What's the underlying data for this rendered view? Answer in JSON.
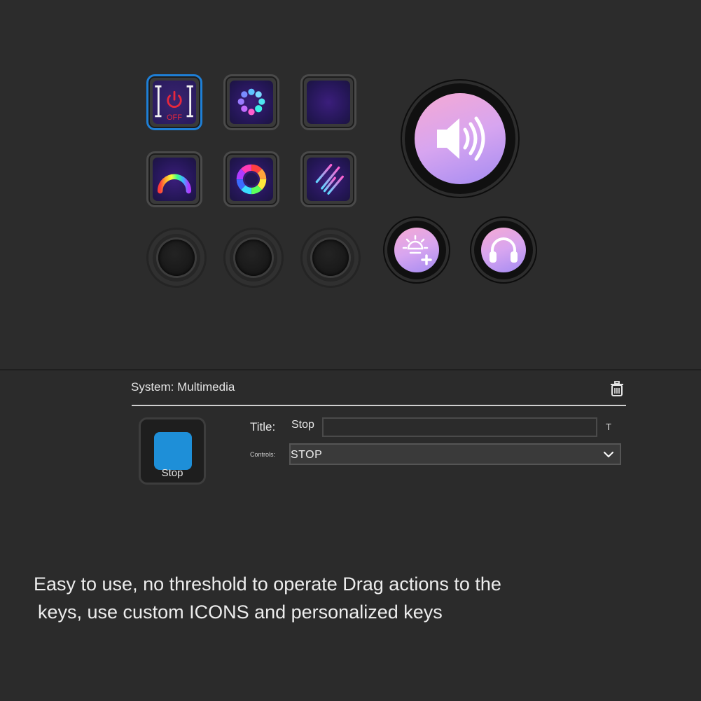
{
  "panel": {
    "title": "System: Multimedia",
    "preview_label": "Stop",
    "title_label": "Title:",
    "title_value": "Stop",
    "title_format_glyph": "T",
    "controls_label": "Controls:",
    "controls_value": "STOP"
  },
  "keys": [
    {
      "name": "power-off-key",
      "icon": "power-off-icon",
      "text": "OFF",
      "selected": true
    },
    {
      "name": "dots-circle-key",
      "icon": "dots-ring-icon"
    },
    {
      "name": "equalizer-key",
      "icon": "equalizer-icon"
    },
    {
      "name": "rainbow-arc-key",
      "icon": "rainbow-arc-icon"
    },
    {
      "name": "color-wheel-key",
      "icon": "color-wheel-icon"
    },
    {
      "name": "meteor-key",
      "icon": "meteor-icon"
    }
  ],
  "round_buttons": [
    {
      "name": "volume-button",
      "icon": "speaker-icon"
    },
    {
      "name": "brightness-up-button",
      "icon": "brightness-plus-icon"
    },
    {
      "name": "headphones-button",
      "icon": "headphones-icon"
    }
  ],
  "caption": {
    "line1": "Easy to use, no threshold to operate Drag actions to the",
    "line2": "keys, use custom ICONS and personalized keys"
  },
  "colors": {
    "accent_blue": "#1e7fd6",
    "stop_blue": "#1e8fd8",
    "power_red": "#e8283c",
    "gradient_pink": "#f6a9d3",
    "gradient_purple": "#a48bf2"
  }
}
